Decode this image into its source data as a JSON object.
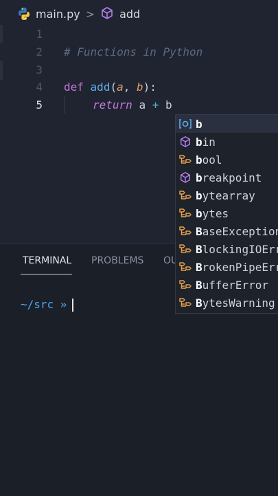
{
  "breadcrumb": {
    "file": "main.py",
    "symbol": "add",
    "separator": ">"
  },
  "editor": {
    "lines": [
      {
        "num": "1"
      },
      {
        "num": "2",
        "comment": "# Functions in Python"
      },
      {
        "num": "3"
      },
      {
        "num": "4",
        "def": "def",
        "name": "add",
        "open": "(",
        "p1": "a",
        "comma": ", ",
        "p2": "b",
        "close": "):"
      },
      {
        "num": "5",
        "ret": "return",
        "a": "a",
        "op": "+",
        "b": "b"
      }
    ]
  },
  "suggestions": [
    {
      "match": "b",
      "rest": "",
      "kind": "variable"
    },
    {
      "match": "b",
      "rest": "in",
      "kind": "function"
    },
    {
      "match": "b",
      "rest": "ool",
      "kind": "class"
    },
    {
      "match": "b",
      "rest": "reakpoint",
      "kind": "function"
    },
    {
      "match": "b",
      "rest": "ytearray",
      "kind": "class"
    },
    {
      "match": "b",
      "rest": "ytes",
      "kind": "class"
    },
    {
      "match": "B",
      "rest": "aseException",
      "kind": "class"
    },
    {
      "match": "B",
      "rest": "lockingIOError",
      "kind": "class"
    },
    {
      "match": "B",
      "rest": "rokenPipeError",
      "kind": "class"
    },
    {
      "match": "B",
      "rest": "ufferError",
      "kind": "class"
    },
    {
      "match": "B",
      "rest": "ytesWarning",
      "kind": "class"
    }
  ],
  "panel": {
    "tabs": [
      "TERMINAL",
      "PROBLEMS",
      "OU"
    ],
    "active_tab": "TERMINAL",
    "prompt": "~/src »"
  },
  "colors": {
    "variable": "#61afef",
    "function": "#b37feb",
    "class": "#e8a04a"
  }
}
